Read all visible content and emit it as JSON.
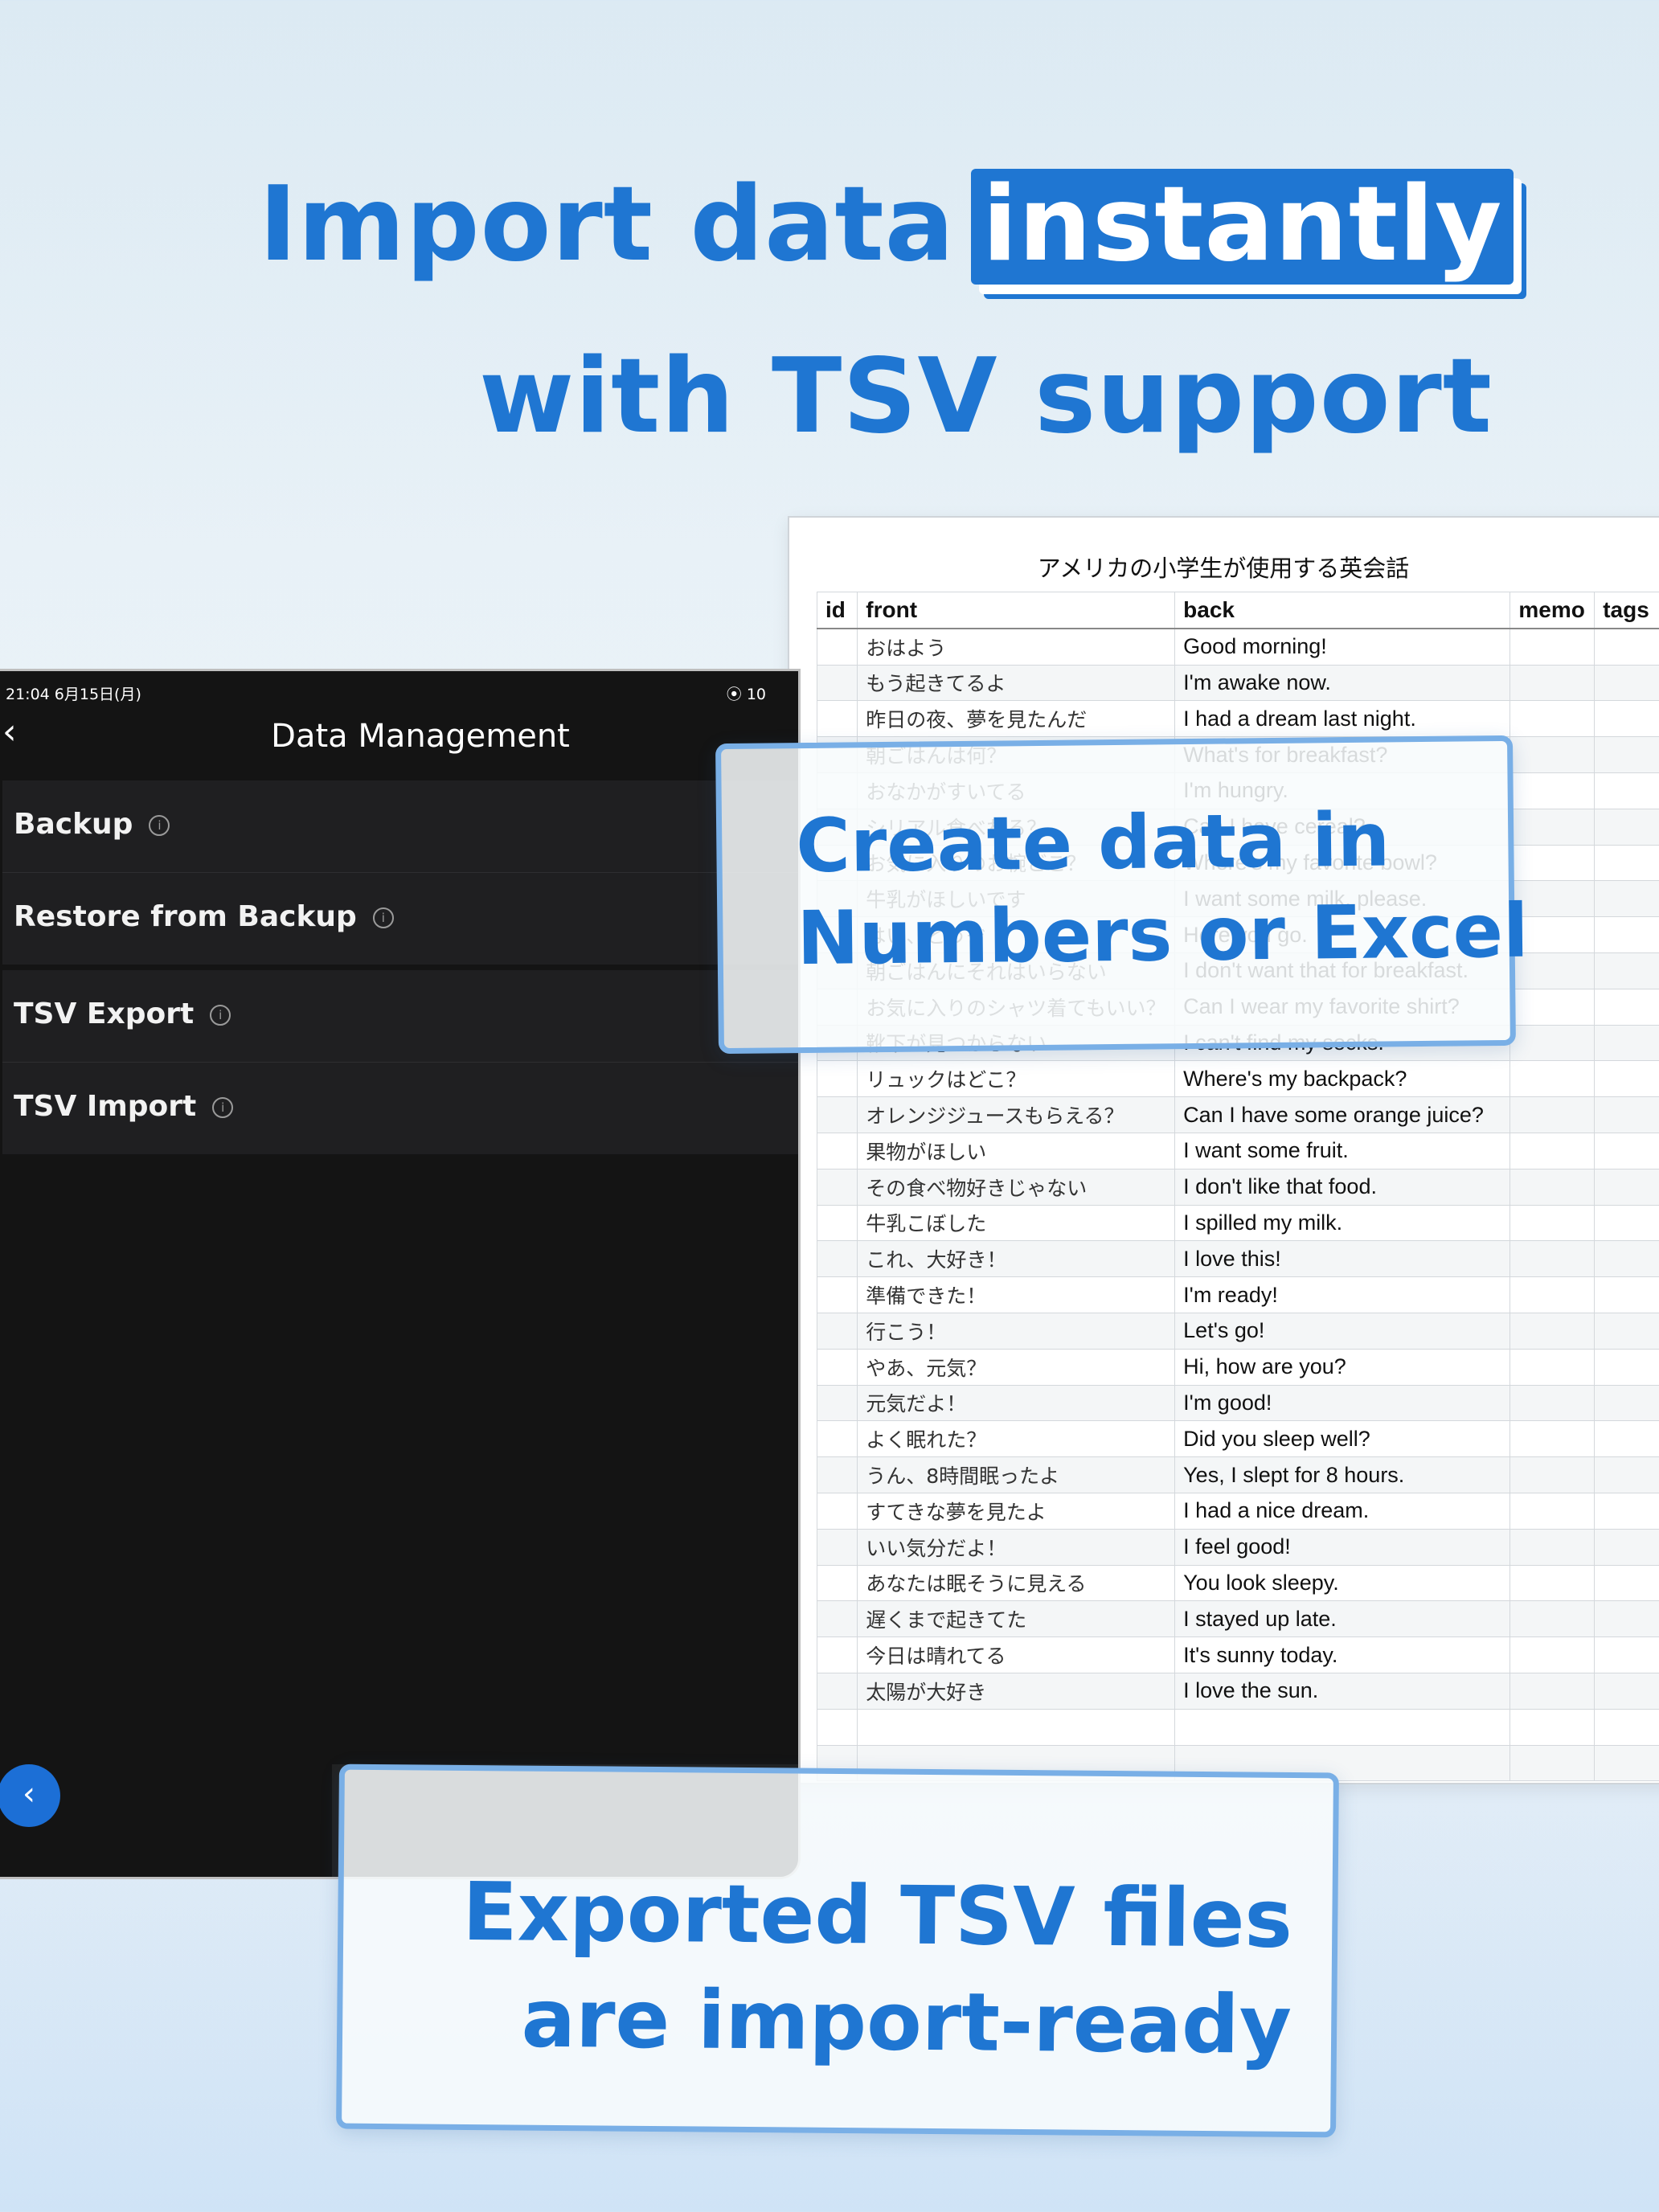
{
  "headline": {
    "line1_prefix": "Import data",
    "line1_highlight": "instantly",
    "line2": "with TSV support"
  },
  "tablet": {
    "status_time": "21:04  6月15日(月)",
    "status_right": "⦿ 10",
    "nav_back": "‹",
    "title": "Data Management",
    "groups": [
      {
        "items": [
          {
            "label": "Backup",
            "info": "i"
          },
          {
            "label": "Restore from Backup",
            "info": "i"
          }
        ]
      },
      {
        "items": [
          {
            "label": "TSV Export",
            "info": "i"
          },
          {
            "label": "TSV Import",
            "info": "i"
          }
        ]
      }
    ],
    "fab_icon": "‹"
  },
  "spreadsheet": {
    "title": "アメリカの小学生が使用する英会話",
    "headers": [
      "id",
      "front",
      "back",
      "memo",
      "tags"
    ],
    "rows": [
      {
        "front": "おはよう",
        "back": "Good morning!"
      },
      {
        "front": "もう起きてるよ",
        "back": "I'm awake now."
      },
      {
        "front": "昨日の夜、夢を見たんだ",
        "back": "I had a dream last night."
      },
      {
        "front": "朝ごはんは何？",
        "back": "What's for breakfast?"
      },
      {
        "front": "おなかがすいてる",
        "back": "I'm hungry."
      },
      {
        "front": "シリアル食べれる？",
        "back": "Can I have cereal?"
      },
      {
        "front": "お気に入りのお椀どこ？",
        "back": "Where's my favorite bowl?"
      },
      {
        "front": "牛乳がほしいです",
        "back": "I want some milk, please."
      },
      {
        "front": "はい、どうぞ",
        "back": "Here you go."
      },
      {
        "front": "朝ごはんにそれはいらない",
        "back": "I don't want that for breakfast."
      },
      {
        "front": "お気に入りのシャツ着てもいい？",
        "back": "Can I wear my favorite shirt?"
      },
      {
        "front": "靴下が見つからない",
        "back": "I can't find my socks."
      },
      {
        "front": "リュックはどこ？",
        "back": "Where's my backpack?"
      },
      {
        "front": "オレンジジュースもらえる？",
        "back": "Can I have some orange juice?"
      },
      {
        "front": "果物がほしい",
        "back": "I want some fruit."
      },
      {
        "front": "その食べ物好きじゃない",
        "back": "I don't like that food."
      },
      {
        "front": "牛乳こぼした",
        "back": "I spilled my milk."
      },
      {
        "front": "これ、大好き！",
        "back": "I love this!"
      },
      {
        "front": "準備できた！",
        "back": "I'm ready!"
      },
      {
        "front": "行こう！",
        "back": "Let's go!"
      },
      {
        "front": "やあ、元気？",
        "back": "Hi, how are you?"
      },
      {
        "front": "元気だよ！",
        "back": "I'm good!"
      },
      {
        "front": "よく眠れた？",
        "back": "Did you sleep well?"
      },
      {
        "front": "うん、8時間眠ったよ",
        "back": "Yes, I slept for 8 hours."
      },
      {
        "front": "すてきな夢を見たよ",
        "back": "I had a nice dream."
      },
      {
        "front": "いい気分だよ！",
        "back": "I feel good!"
      },
      {
        "front": "あなたは眠そうに見える",
        "back": "You look sleepy."
      },
      {
        "front": "遅くまで起きてた",
        "back": "I stayed up late."
      },
      {
        "front": "今日は晴れてる",
        "back": "It's sunny today."
      },
      {
        "front": "太陽が大好き",
        "back": "I love the sun."
      },
      {
        "front": "",
        "back": ""
      },
      {
        "front": "",
        "back": ""
      }
    ]
  },
  "callouts": {
    "create": {
      "line1": "Create data in",
      "line2": "Numbers or Excel"
    },
    "export": {
      "line1": "Exported TSV files",
      "line2": "are import-ready"
    }
  }
}
